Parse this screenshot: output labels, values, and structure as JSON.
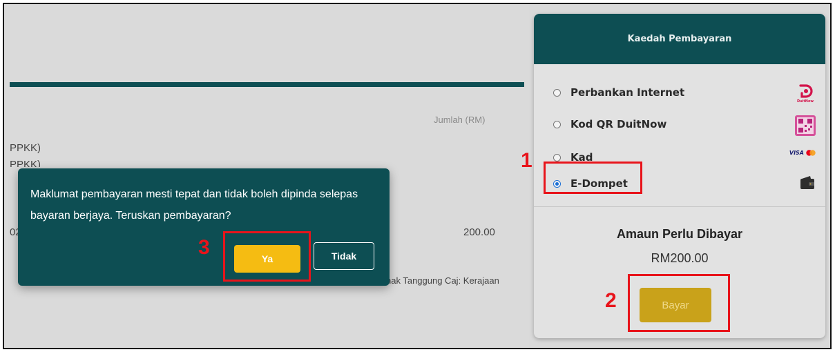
{
  "background_table": {
    "column_header": "Jumlah (RM)",
    "description_line1": "PPKK)",
    "description_line2": "PPKK)",
    "row_code_fragment": "02",
    "row_amount": "200.00",
    "charge_note": "nak Tanggung Caj: Kerajaan"
  },
  "dialog": {
    "message": "Maklumat pembayaran mesti tepat dan tidak boleh dipinda selepas bayaran berjaya. Teruskan pembayaran?",
    "confirm_label": "Ya",
    "cancel_label": "Tidak"
  },
  "payment_panel": {
    "header": "Kaedah Pembayaran",
    "methods": [
      {
        "label": "Perbankan Internet",
        "selected": false,
        "logo": "duitnow-logo"
      },
      {
        "label": "Kod QR DuitNow",
        "selected": false,
        "logo": "qr-code-icon"
      },
      {
        "label": "Kad",
        "selected": false,
        "logo": "visa-mastercard-logo"
      },
      {
        "label": "E-Dompet",
        "selected": true,
        "logo": "wallet-icon"
      }
    ],
    "duitnow_logo_text": "DuitNow",
    "visa_text": "VISA",
    "amount_title": "Amaun Perlu Dibayar",
    "amount_value": "RM200.00",
    "pay_label": "Bayar"
  },
  "annotations": {
    "step1": "1",
    "step2": "2",
    "step3": "3"
  },
  "colors": {
    "teal": "#0d4e53",
    "yellow_button": "#f5bc12",
    "bayar_button": "#c9a21a",
    "annotation_red": "#e8141b",
    "radio_selected": "#1a6fd6"
  }
}
